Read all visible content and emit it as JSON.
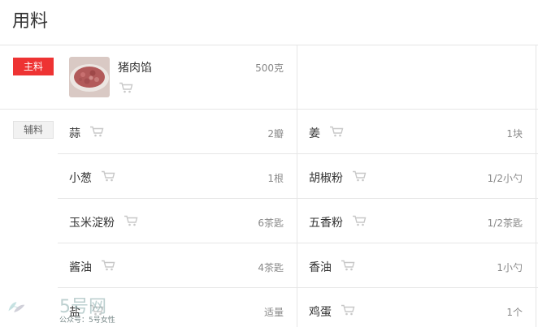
{
  "title": "用料",
  "sections": {
    "main_label": "主料",
    "aux_label": "辅料"
  },
  "main_ingredient": {
    "name": "猪肉馅",
    "qty": "500克"
  },
  "aux": [
    {
      "left": {
        "name": "蒜",
        "qty": "2瓣"
      },
      "right": {
        "name": "姜",
        "qty": "1块"
      }
    },
    {
      "left": {
        "name": "小葱",
        "qty": "1根"
      },
      "right": {
        "name": "胡椒粉",
        "qty": "1/2小勺"
      }
    },
    {
      "left": {
        "name": "玉米淀粉",
        "qty": "6茶匙"
      },
      "right": {
        "name": "五香粉",
        "qty": "1/2茶匙"
      }
    },
    {
      "left": {
        "name": "酱油",
        "qty": "4茶匙"
      },
      "right": {
        "name": "香油",
        "qty": "1小勺"
      }
    },
    {
      "left": {
        "name": "盐",
        "qty": "适量"
      },
      "right": {
        "name": "鸡蛋",
        "qty": "1个"
      }
    }
  ],
  "watermark": {
    "brand": "5号网",
    "sub": "公众号：5号女性"
  },
  "colors": {
    "accent": "#ee3333",
    "divider": "#e6e6e6",
    "cart_icon": "#c8c8c8"
  }
}
